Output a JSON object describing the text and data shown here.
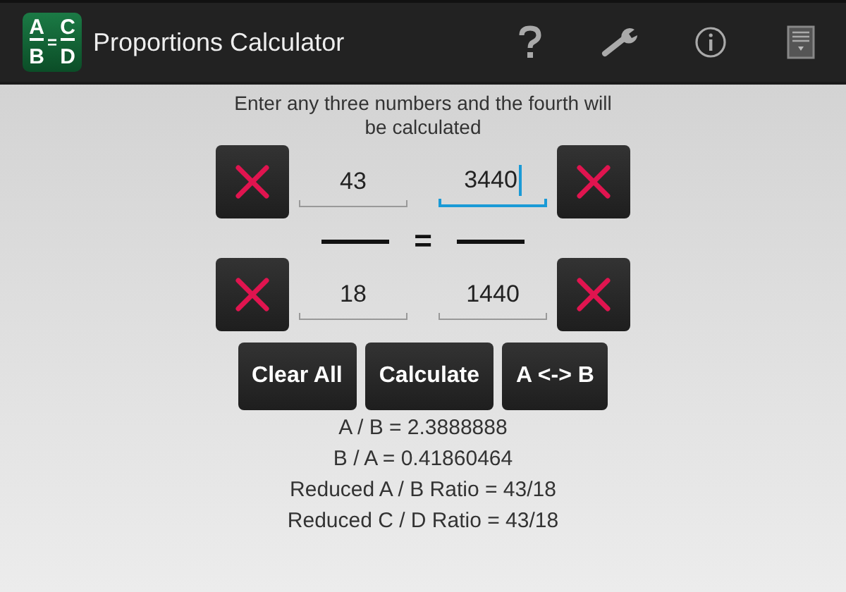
{
  "app_bar": {
    "title": "Proportions Calculator",
    "logo": {
      "top_left": "A",
      "top_right": "C",
      "bottom_left": "B",
      "bottom_right": "D",
      "equals": "="
    }
  },
  "instructions": "Enter any three numbers and the fourth will be calculated",
  "rows": [
    {
      "left_value": "43",
      "left_focused": false,
      "right_value": "3440",
      "right_focused": true
    },
    {
      "left_value": "18",
      "left_focused": false,
      "right_value": "1440",
      "right_focused": false
    }
  ],
  "equals": "=",
  "buttons": [
    "Clear All",
    "Calculate",
    "A <-> B"
  ],
  "results": [
    "A / B = 2.3888888",
    "B / A = 0.41860464",
    "Reduced A / B Ratio = 43/18",
    "Reduced C / D Ratio = 43/18"
  ]
}
